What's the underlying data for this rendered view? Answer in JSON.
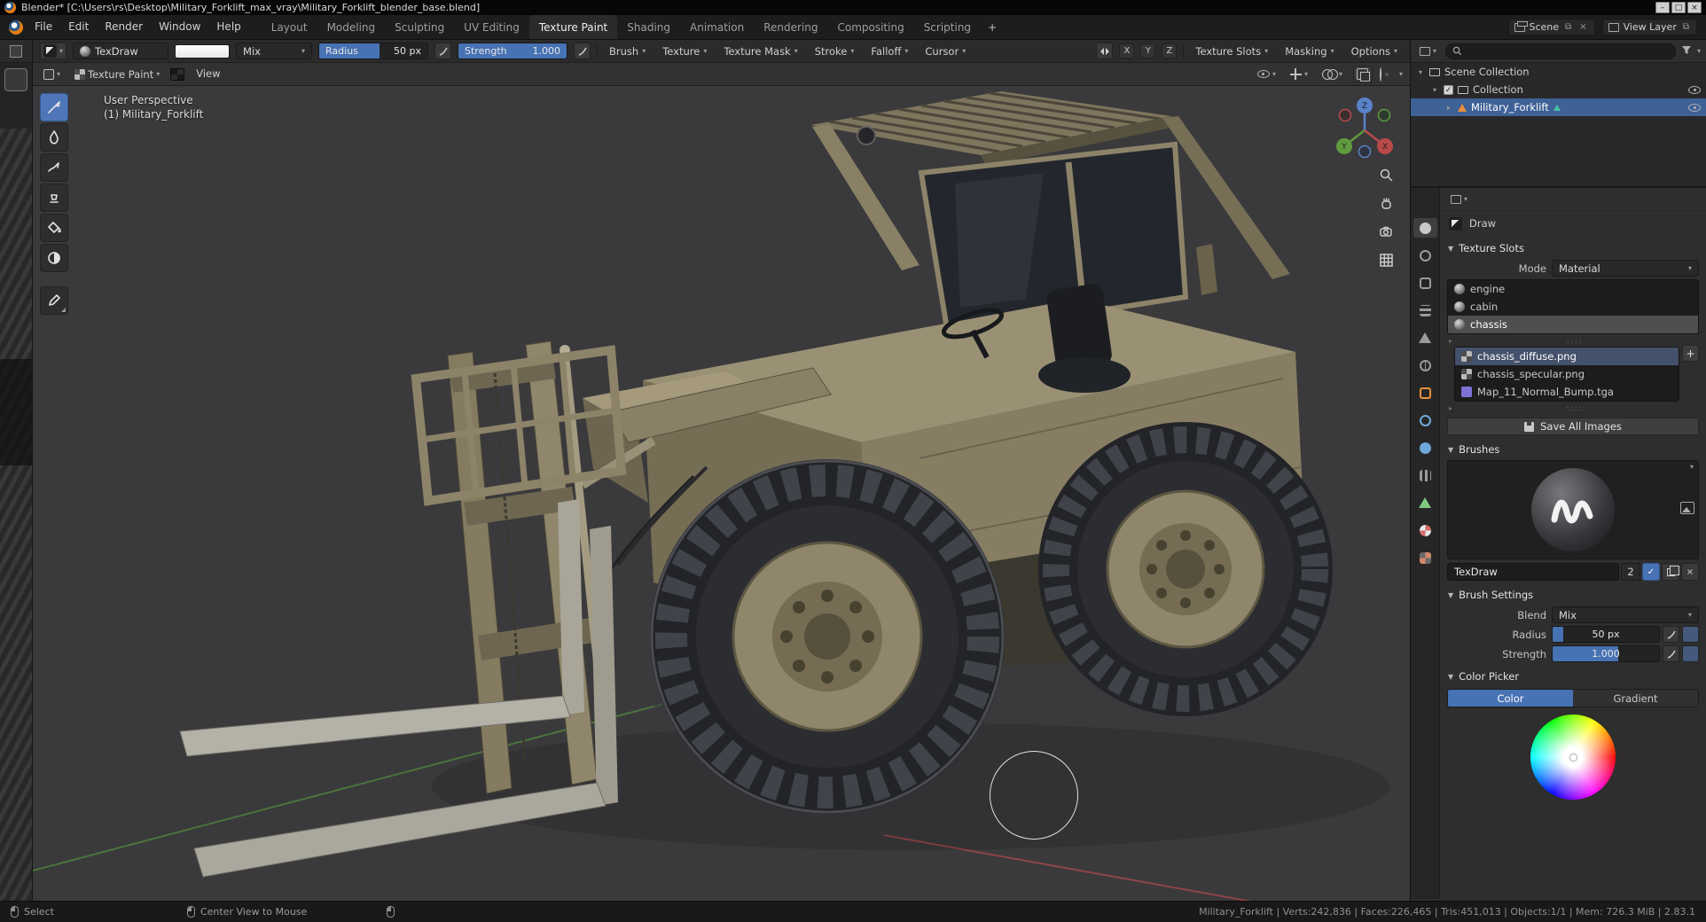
{
  "window": {
    "title": "Blender* [C:\\Users\\rs\\Desktop\\Military_Forklift_max_vray\\Military_Forklift_blender_base.blend]"
  },
  "topbar": {
    "menus": [
      "File",
      "Edit",
      "Render",
      "Window",
      "Help"
    ],
    "workspaces": [
      "Layout",
      "Modeling",
      "Sculpting",
      "UV Editing",
      "Texture Paint",
      "Shading",
      "Animation",
      "Rendering",
      "Compositing",
      "Scripting"
    ],
    "new_workspace_button": "+",
    "scene_label": "Scene",
    "view_layer_label": "View Layer"
  },
  "tool_settings": {
    "brush_name": "TexDraw",
    "blend": "Mix",
    "radius_label": "Radius",
    "radius_value": "50 px",
    "strength_label": "Strength",
    "strength_value": "1.000",
    "popovers": [
      "Brush",
      "Texture",
      "Texture Mask",
      "Stroke",
      "Falloff",
      "Cursor"
    ],
    "mirror_axes": [
      "X",
      "Y",
      "Z"
    ],
    "right_popovers": [
      "Texture Slots",
      "Masking",
      "Options"
    ]
  },
  "viewport_header": {
    "mode": "Texture Paint",
    "view_menu": "View"
  },
  "viewport": {
    "overlay_title": "User Perspective",
    "overlay_subtitle": "(1) Military_Forklift",
    "gizmo_axes": [
      "X",
      "Y",
      "Z"
    ]
  },
  "outliner": {
    "rows": [
      {
        "label": "Scene Collection"
      },
      {
        "label": "Collection"
      },
      {
        "label": "Military_Forklift"
      }
    ]
  },
  "properties": {
    "active_tool": "Draw",
    "texture_slots": {
      "title": "Texture Slots",
      "mode_label": "Mode",
      "mode_value": "Material",
      "materials": [
        "engine",
        "cabin",
        "chassis"
      ],
      "textures": [
        "chassis_diffuse.png",
        "chassis_specular.png",
        "Map_11_Normal_Bump.tga"
      ],
      "add_button": "+",
      "save_all": "Save All Images"
    },
    "brushes": {
      "title": "Brushes",
      "name": "TexDraw",
      "users": "2"
    },
    "brush_settings": {
      "title": "Brush Settings",
      "blend_label": "Blend",
      "blend_value": "Mix",
      "radius_label": "Radius",
      "radius_value": "50 px",
      "strength_label": "Strength",
      "strength_value": "1.000"
    },
    "color_picker": {
      "title": "Color Picker",
      "tab_color": "Color",
      "tab_gradient": "Gradient"
    }
  },
  "statusbar": {
    "select": "Select",
    "center_view": "Center View to Mouse",
    "stats": "Military_Forklift | Verts:242,836 | Faces:226,465 | Tris:451,013 | Objects:1/1 | Mem: 726.3 MiB | 2.83.1"
  },
  "colors": {
    "accent": "#4772b3",
    "selected_outliner_row": "#3e6196",
    "khaki": "#8d8369"
  }
}
